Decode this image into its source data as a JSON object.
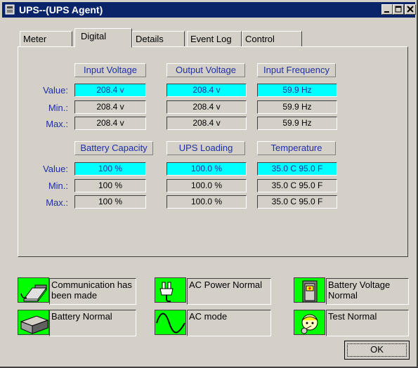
{
  "window": {
    "title": "UPS--(UPS Agent)"
  },
  "tabs": [
    "Meter",
    "Digital",
    "Details",
    "Event Log",
    "Control"
  ],
  "active_tab": "Digital",
  "row_labels": [
    "Value:",
    "Min.:",
    "Max.:"
  ],
  "groups": [
    {
      "headers": [
        "Input Voltage",
        "Output Voltage",
        "Input Frequency"
      ],
      "rows": [
        [
          "208.4 v",
          "208.4 v",
          "59.9 Hz"
        ],
        [
          "208.4 v",
          "208.4 v",
          "59.9 Hz"
        ],
        [
          "208.4 v",
          "208.4 v",
          "59.9 Hz"
        ]
      ]
    },
    {
      "headers": [
        "Battery Capacity",
        "UPS Loading",
        "Temperature"
      ],
      "rows": [
        [
          "100 %",
          "100.0 %",
          "35.0 C  95.0 F"
        ],
        [
          "100 %",
          "100.0 %",
          "35.0 C  95.0 F"
        ],
        [
          "100 %",
          "100.0 %",
          "35.0 C  95.0 F"
        ]
      ]
    }
  ],
  "status": [
    {
      "icon": "communication-icon",
      "text": "Communication has been made"
    },
    {
      "icon": "ac-plug-icon",
      "text": "AC Power Normal"
    },
    {
      "icon": "battery-voltage-icon",
      "text": "Battery Voltage Normal"
    },
    {
      "icon": "battery-icon",
      "text": "Battery Normal"
    },
    {
      "icon": "sine-wave-icon",
      "text": "AC mode"
    },
    {
      "icon": "test-icon",
      "text": "Test Normal"
    }
  ],
  "ok_label": "OK",
  "colors": {
    "title_bar": "#0a246a",
    "value_cell": "#00ffff",
    "status_ok": "#00ff00",
    "label_text": "#1e2fa8"
  }
}
